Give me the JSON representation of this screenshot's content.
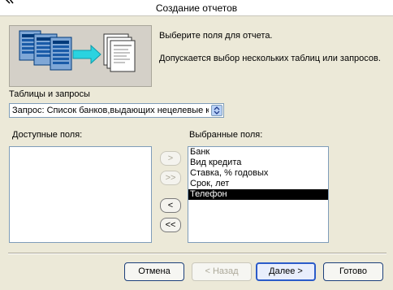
{
  "window": {
    "title": "Создание отчетов"
  },
  "intro": {
    "line1": "Выберите поля для отчета.",
    "line2": "Допускается выбор нескольких таблиц или запросов."
  },
  "source": {
    "label": "Таблицы и запросы",
    "selected": "Запрос: Список банков,выдающих нецелевые кредиты"
  },
  "available_fields": {
    "label": "Доступные поля:",
    "items": []
  },
  "selected_fields": {
    "label": "Выбранные поля:",
    "items": [
      "Банк",
      "Вид кредита",
      "Ставка, % годовых",
      "Срок, лет",
      "Телефон"
    ],
    "selected_item": "Телефон"
  },
  "move_buttons": {
    "add_one": ">",
    "add_all": ">>",
    "remove_one": "<",
    "remove_all": "<<"
  },
  "footer": {
    "cancel": "Отмена",
    "back": "< Назад",
    "next": "Далее >",
    "finish": "Готово"
  },
  "colors": {
    "dialog_bg": "#ece9d8",
    "list_selection": "#000000",
    "default_button_border": "#2b5bc9"
  }
}
